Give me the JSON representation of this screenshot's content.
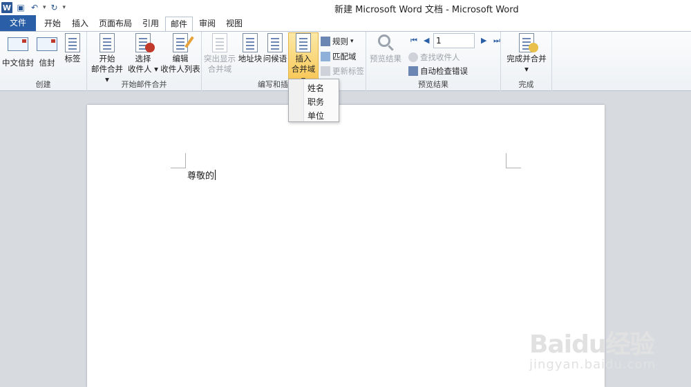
{
  "window": {
    "title": "新建 Microsoft Word 文档 - Microsoft Word",
    "app_icon_letter": "W"
  },
  "quick_access": {
    "items": [
      "save-icon",
      "undo-icon",
      "redo-icon",
      "customize-icon"
    ]
  },
  "tabs": [
    {
      "label": "文件"
    },
    {
      "label": "开始"
    },
    {
      "label": "插入"
    },
    {
      "label": "页面布局"
    },
    {
      "label": "引用"
    },
    {
      "label": "邮件",
      "active": true
    },
    {
      "label": "审阅"
    },
    {
      "label": "视图"
    }
  ],
  "ribbon": {
    "create": {
      "label": "创建",
      "chinese_envelope": "中文信封",
      "envelope": "信封",
      "labels": "标签"
    },
    "start_merge": {
      "label": "开始邮件合并",
      "start_line1": "开始",
      "start_line2": "邮件合并",
      "select_line1": "选择",
      "select_line2": "收件人",
      "edit_line1": "编辑",
      "edit_line2": "收件人列表"
    },
    "write_insert": {
      "label": "编写和插",
      "highlight_line1": "突出显示",
      "highlight_line2": "合并域",
      "address_block": "地址块",
      "greeting": "问候语",
      "insert_field_line1": "插入",
      "insert_field_line2": "合并域",
      "rules": "规则",
      "match_fields": "匹配域",
      "update_labels": "更新标签"
    },
    "preview": {
      "label": "预览结果",
      "preview_results": "预览结果",
      "find_recipient": "查找收件人",
      "auto_check": "自动检查错误",
      "record_value": "1"
    },
    "finish": {
      "label": "完成",
      "finish_merge": "完成并合并"
    }
  },
  "dropdown": {
    "items": [
      "姓名",
      "职务",
      "单位"
    ]
  },
  "document": {
    "text": "尊敬的"
  },
  "watermark": {
    "logo": "Baidu经验",
    "url": "jingyan.baidu.com"
  },
  "colors": {
    "file_tab": "#2a5ea6",
    "highlight": "#f8c95a",
    "background": "#d7dbe0"
  }
}
